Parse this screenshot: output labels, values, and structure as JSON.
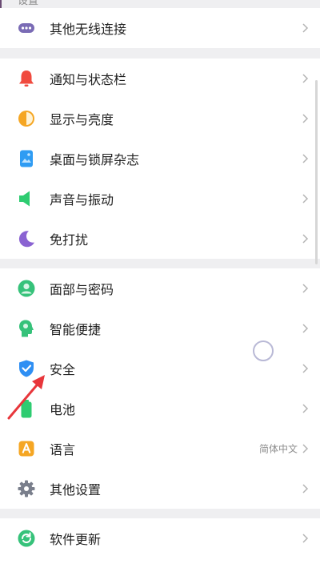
{
  "header_fragment": "设置",
  "groups": [
    {
      "items": [
        {
          "label": "其他无线连接",
          "icon": "more-dots-icon",
          "color": "#7a6bb5"
        }
      ]
    },
    {
      "items": [
        {
          "label": "通知与状态栏",
          "icon": "bell-icon",
          "color": "#f04a3e"
        },
        {
          "label": "显示与亮度",
          "icon": "brightness-icon",
          "color": "#f5a623"
        },
        {
          "label": "桌面与锁屏杂志",
          "icon": "wallpaper-icon",
          "color": "#2f9cf3"
        },
        {
          "label": "声音与振动",
          "icon": "speaker-icon",
          "color": "#2ecc71"
        },
        {
          "label": "免打扰",
          "icon": "moon-icon",
          "color": "#8a63d2"
        }
      ]
    },
    {
      "items": [
        {
          "label": "面部与密码",
          "icon": "face-icon",
          "color": "#36c27a"
        },
        {
          "label": "智能便捷",
          "icon": "smart-head-icon",
          "color": "#36c27a"
        },
        {
          "label": "安全",
          "icon": "shield-check-icon",
          "color": "#2f8ff3"
        },
        {
          "label": "电池",
          "icon": "battery-icon",
          "color": "#2ecc71"
        },
        {
          "label": "语言",
          "icon": "language-icon",
          "color": "#f5a623",
          "value": "简体中文"
        },
        {
          "label": "其他设置",
          "icon": "gear-icon",
          "color": "#7a7f8c"
        }
      ]
    },
    {
      "items": [
        {
          "label": "软件更新",
          "icon": "update-icon",
          "color": "#36c27a"
        }
      ]
    }
  ],
  "annotations": {
    "arrow_color": "#e8363b",
    "touch_indicator_color": "#b9b9d6"
  }
}
